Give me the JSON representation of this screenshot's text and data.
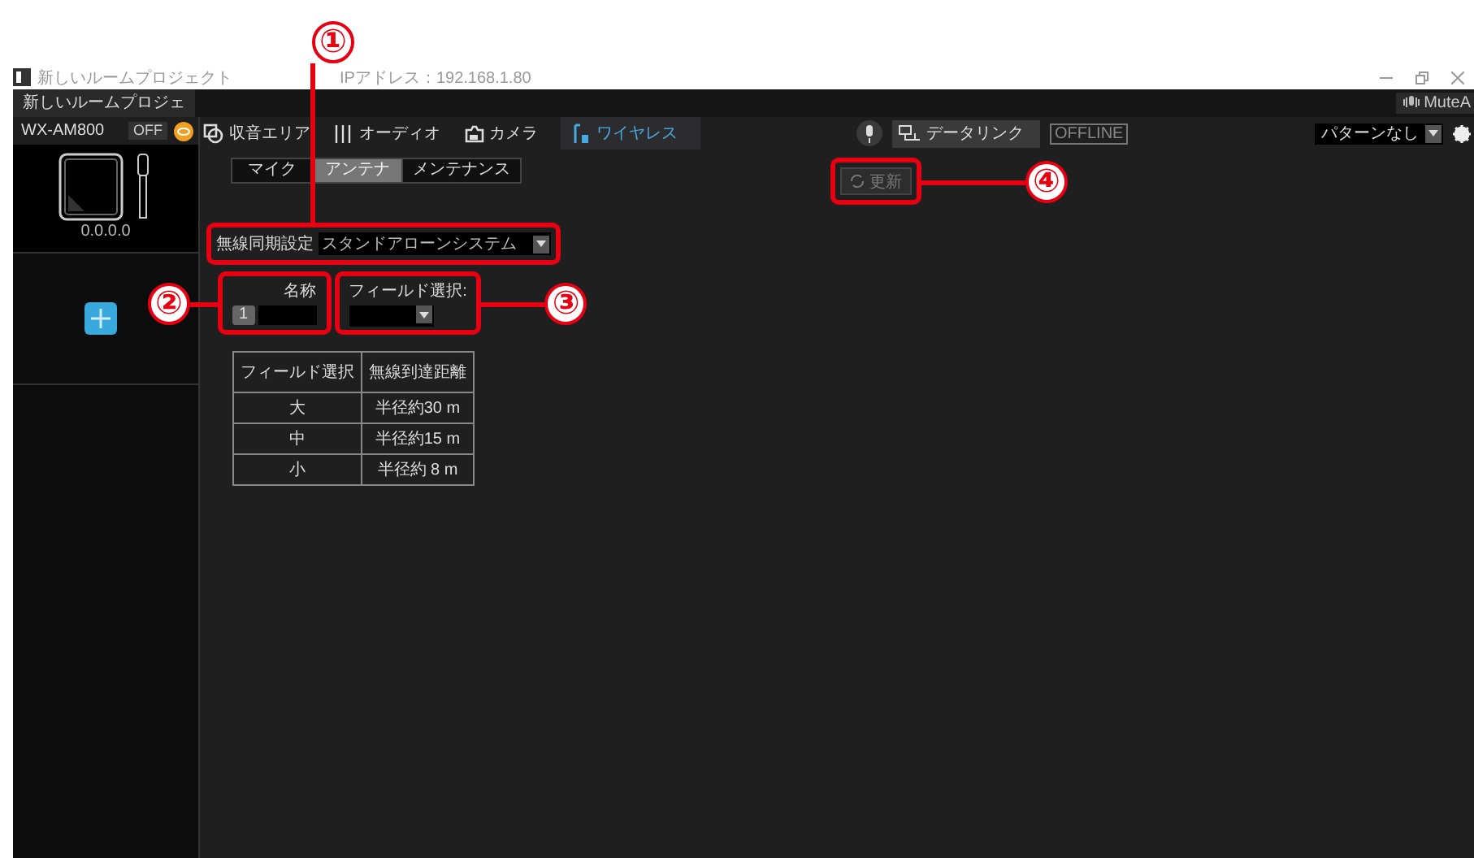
{
  "callouts": [
    {
      "number": "①"
    },
    {
      "number": "②"
    },
    {
      "number": "③"
    },
    {
      "number": "④"
    }
  ],
  "window": {
    "title": "新しいルームプロジェクト",
    "ip": "IPアドレス：192.168.1.80"
  },
  "project_tab": "新しいルームプロジェ",
  "mute_label": "MuteA",
  "device": {
    "name": "WX-AM800",
    "power": "OFF",
    "address": "0.0.0.0"
  },
  "tabs": [
    {
      "label": "収音エリア",
      "selected": false
    },
    {
      "label": "オーディオ",
      "selected": false
    },
    {
      "label": "カメラ",
      "selected": false
    },
    {
      "label": "ワイヤレス",
      "selected": true
    }
  ],
  "datalink": {
    "label": "データリンク",
    "status": "OFFLINE"
  },
  "pattern": {
    "value": "パターンなし"
  },
  "subtabs": [
    {
      "label": "マイク",
      "selected": false
    },
    {
      "label": "アンテナ",
      "selected": true
    },
    {
      "label": "メンテナンス",
      "selected": false
    }
  ],
  "update_button": {
    "label": "更新",
    "disabled": true
  },
  "sync": {
    "label": "無線同期設定",
    "value": "スタンドアローンシステム"
  },
  "name_field": {
    "label": "名称",
    "index": "1"
  },
  "field_select": {
    "label": "フィールド選択:"
  },
  "table": {
    "columns": [
      "フィールド選択",
      "無線到達距離"
    ],
    "rows": [
      [
        "大",
        "半径約30 m"
      ],
      [
        "中",
        "半径約15 m"
      ],
      [
        "小",
        "半径約 8 m"
      ]
    ]
  }
}
